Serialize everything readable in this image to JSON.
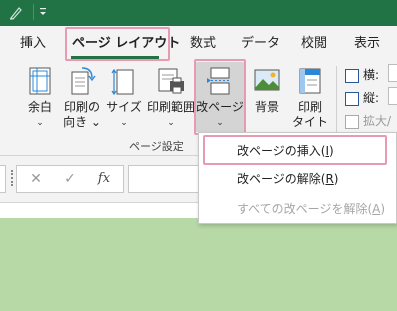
{
  "tabs": [
    {
      "label": "挿入"
    },
    {
      "label": "ページ レイアウト",
      "active": true
    },
    {
      "label": "数式"
    },
    {
      "label": "データ"
    },
    {
      "label": "校閲"
    },
    {
      "label": "表示"
    }
  ],
  "ribbon": {
    "margins": {
      "line1": "余白",
      "chevron": "⌄"
    },
    "orientation": {
      "line1": "印刷の",
      "line2": "向き ⌄"
    },
    "size": {
      "line1": "サイズ",
      "chevron": "⌄"
    },
    "print_area": {
      "line1": "印刷範囲",
      "chevron": "⌄"
    },
    "breaks": {
      "line1": "改ページ",
      "chevron": "⌄"
    },
    "background": {
      "line1": "背景"
    },
    "print_titles": {
      "line1": "印刷",
      "line2": "タイトル"
    },
    "group_label": "ページ設定",
    "scale": {
      "width_label": "横:",
      "height_label": "縦:",
      "scale_label": "拡大/"
    }
  },
  "formula_bar": {
    "cancel": "✕",
    "enter": "✓",
    "fx": "fx"
  },
  "breaks_menu": {
    "insert": {
      "text": "改ページの挿入(",
      "key": "I",
      "close": ")"
    },
    "remove": {
      "text": "改ページの解除(",
      "key": "R",
      "close": ")"
    },
    "reset": {
      "text": "すべての改ページを解除(",
      "key": "A",
      "close": ")"
    }
  },
  "colors": {
    "accent": "#217346",
    "highlight": "#e89ab0",
    "sheet": "#b7d9a6"
  }
}
